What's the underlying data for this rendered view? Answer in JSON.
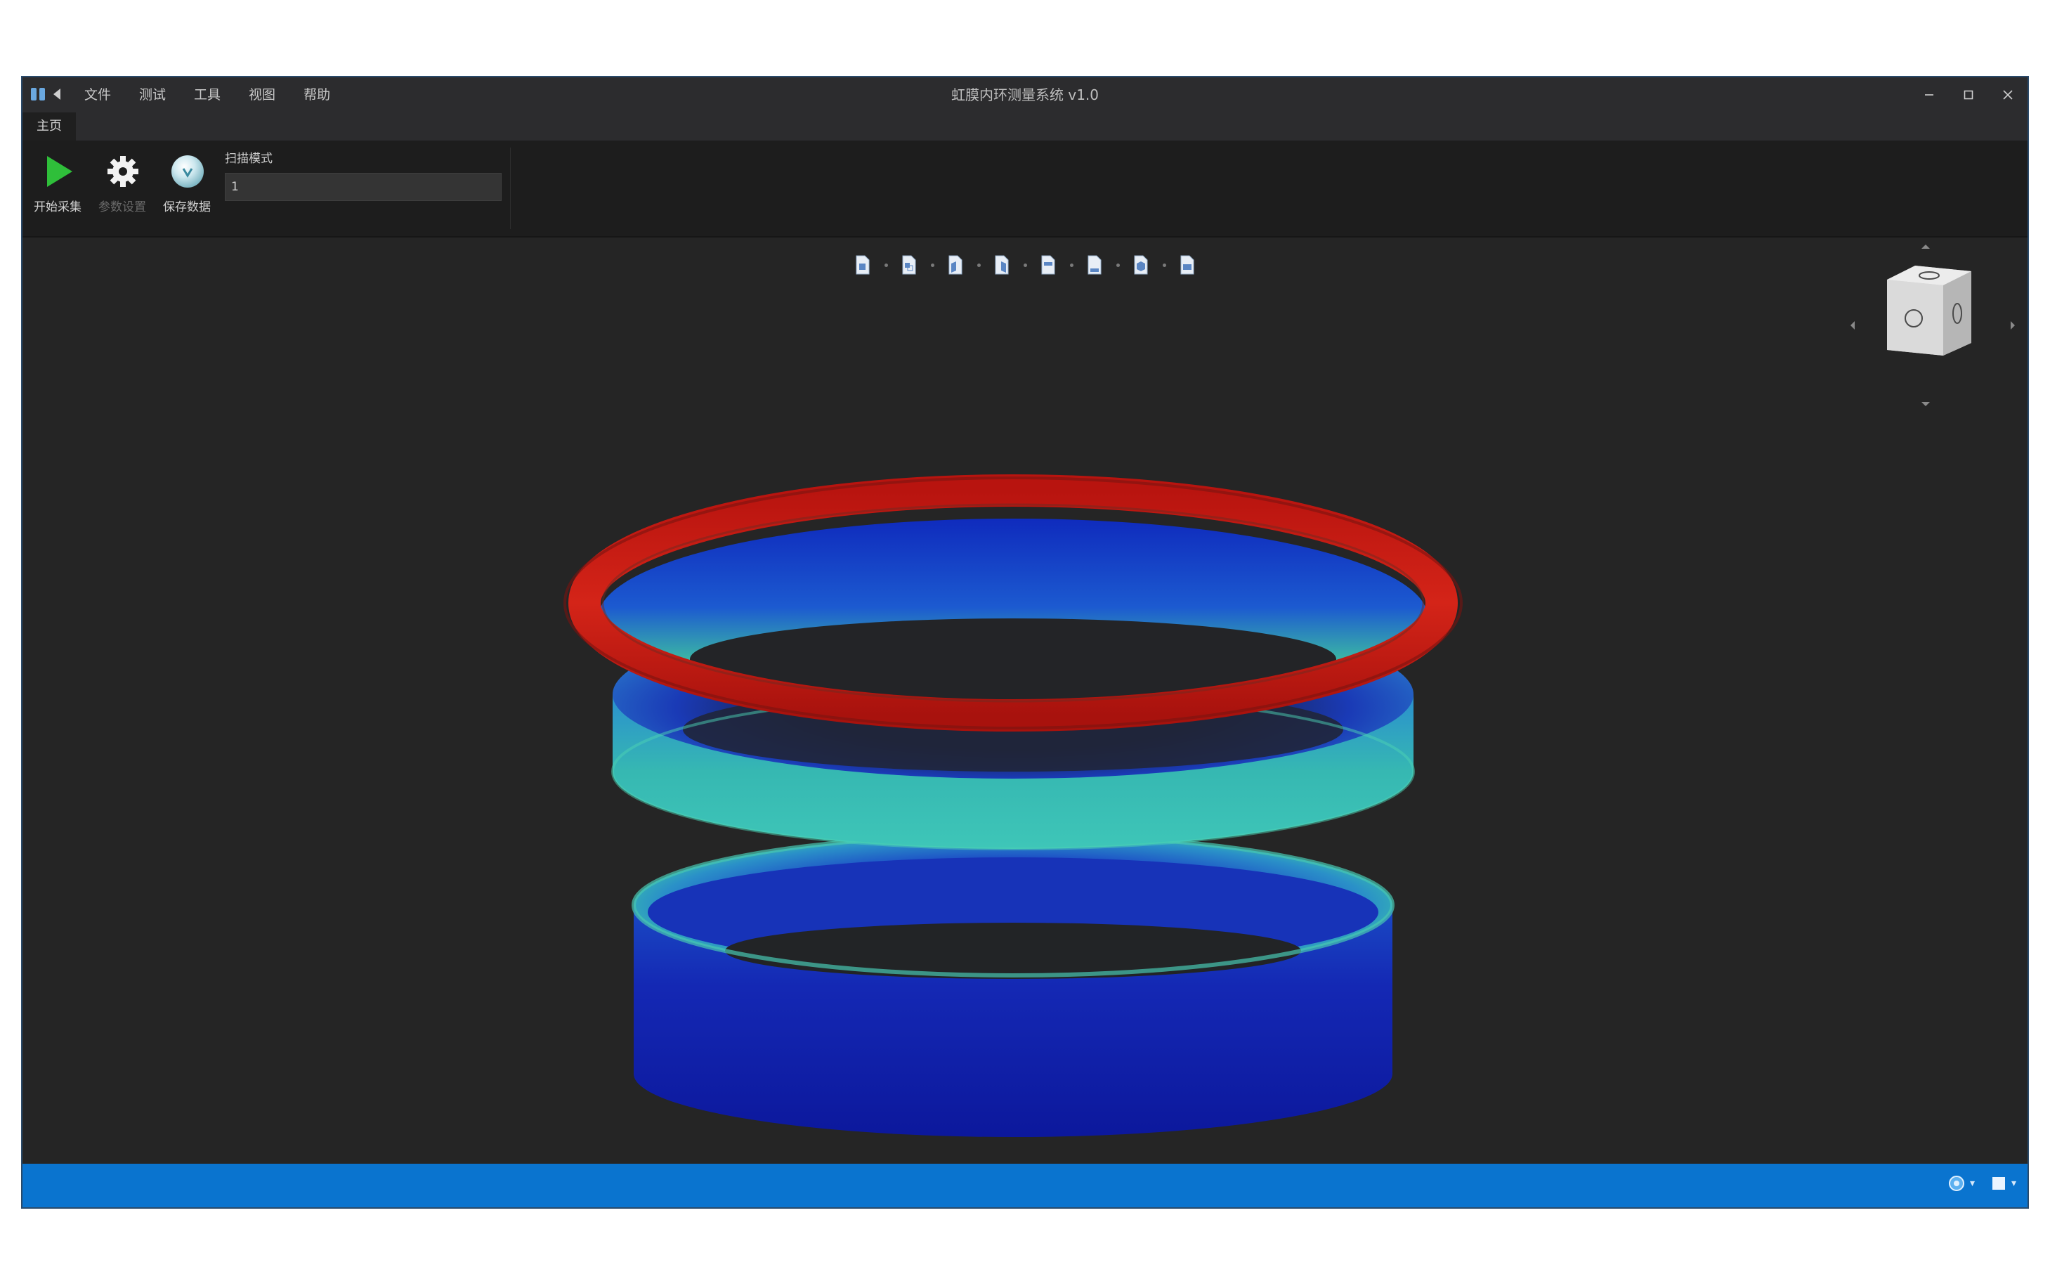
{
  "window": {
    "title": "虹膜内环测量系统 v1.0",
    "menu": [
      "文件",
      "测试",
      "工具",
      "视图",
      "帮助"
    ],
    "controls": [
      "minimize-icon",
      "maximize-icon",
      "close-icon"
    ]
  },
  "tabs": [
    "主页"
  ],
  "ribbon": {
    "buttons": [
      {
        "label": "开始采集",
        "icon": "play-icon",
        "enabled": true
      },
      {
        "label": "参数设置",
        "icon": "gear-icon",
        "enabled": false
      },
      {
        "label": "保存数据",
        "icon": "disc-icon",
        "enabled": true
      }
    ],
    "param_label": "扫描模式",
    "param_value": "1"
  },
  "view_toolbar": {
    "icons": [
      "view-front-icon",
      "view-back-icon",
      "view-left-icon",
      "view-right-icon",
      "view-top-icon",
      "view-bottom-icon",
      "view-iso-icon",
      "view-reset-icon"
    ]
  },
  "point_cloud": {
    "description_colors": {
      "high": "#cc1f1a",
      "mid": "#3ec79a",
      "low": "#1424b8"
    }
  },
  "status_bar": {
    "color": "#0a74cf",
    "items": [
      "camera-icon",
      "display-icon"
    ]
  }
}
